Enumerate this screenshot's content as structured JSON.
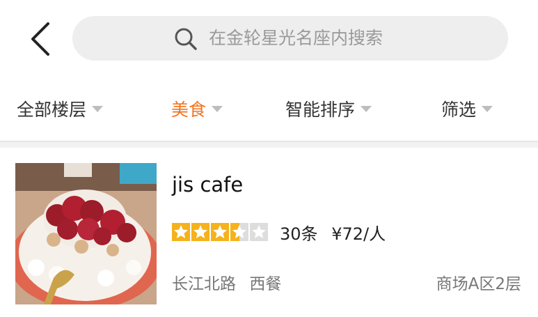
{
  "header": {
    "back_icon": "chevron-left-icon",
    "search_icon": "search-icon",
    "search_placeholder": "在金轮星光名座内搜索"
  },
  "filters": [
    {
      "label": "全部楼层",
      "active": false
    },
    {
      "label": "美食",
      "active": true
    },
    {
      "label": "智能排序",
      "active": false
    },
    {
      "label": "筛选",
      "active": false
    }
  ],
  "colors": {
    "accent": "#f2731f",
    "star": "#f5b21b",
    "star_empty": "#dddddd"
  },
  "result": {
    "name": "jis cafe",
    "rating": 3.5,
    "rating_max": 5,
    "reviews": "30条",
    "price": "¥72/人",
    "area": "长江北路",
    "category": "西餐",
    "location": "商场A区2层"
  }
}
